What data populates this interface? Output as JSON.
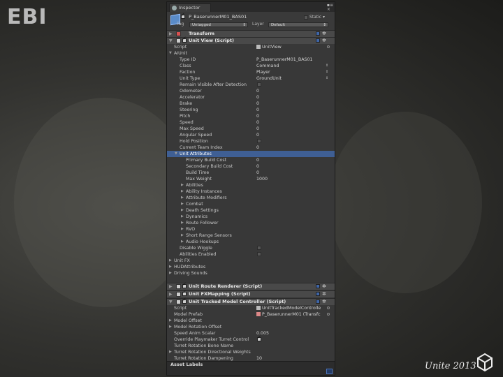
{
  "branding": {
    "logo_text": "EBI",
    "event_text": "Unite 2013"
  },
  "inspector": {
    "tab_label": "Inspector",
    "object": {
      "name": "P_BaserunnerM01_BAS01",
      "static_label": "Static",
      "tag_label": "Tag",
      "tag_value": "Untagged",
      "layer_label": "Layer",
      "layer_value": "Default"
    },
    "transform": {
      "title": "Transform"
    },
    "unit_view": {
      "title": "Unit View (Script)",
      "script_label": "Script",
      "script_value": "UnitView",
      "aiunit_label": "AIUnit",
      "fields": [
        {
          "label": "Type ID",
          "value": "P_BaserunnerM01_BAS01"
        },
        {
          "label": "Class",
          "value": "Command"
        },
        {
          "label": "Faction",
          "value": "Player"
        },
        {
          "label": "Unit Type",
          "value": "GroundUnit"
        },
        {
          "label": "Remain Visible After Detection",
          "value": ""
        },
        {
          "label": "Odometer",
          "value": "0"
        },
        {
          "label": "Accelerator",
          "value": "0"
        },
        {
          "label": "Brake",
          "value": "0"
        },
        {
          "label": "Steering",
          "value": "0"
        },
        {
          "label": "Pitch",
          "value": "0"
        },
        {
          "label": "Speed",
          "value": "0"
        },
        {
          "label": "Max Speed",
          "value": "0"
        },
        {
          "label": "Angular Speed",
          "value": "0"
        },
        {
          "label": "Hold Position",
          "value": ""
        },
        {
          "label": "Current Team Index",
          "value": "0"
        }
      ],
      "unit_attributes_label": "Unit Attributes",
      "attributes": [
        {
          "label": "Primary Build Cost",
          "value": "0"
        },
        {
          "label": "Secondary Build Cost",
          "value": "0"
        },
        {
          "label": "Build Time",
          "value": "0"
        },
        {
          "label": "Max Weight",
          "value": "1000"
        }
      ],
      "attribute_groups": [
        "Abilities",
        "Ability Instances",
        "Attribute Modifiers",
        "Combat",
        "Death Settings",
        "Dynamics",
        "Route Follower",
        "RVO",
        "Short Range Sensors",
        "Audio Hookups"
      ],
      "flags": [
        {
          "label": "Disable Wiggle",
          "value": ""
        },
        {
          "label": "Abilities Enabled",
          "value": ""
        }
      ],
      "other_groups": [
        "Unit FX",
        "HUDAttributes",
        "Driving Sounds"
      ]
    },
    "unit_route_renderer": {
      "title": "Unit Route Renderer (Script)"
    },
    "unit_fx_mapping": {
      "title": "Unit FXMapping (Script)"
    },
    "tracked_model": {
      "title": "Unit Tracked Model Controller (Script)",
      "rows": [
        {
          "label": "Script",
          "value": "UnitTrackedModelControlle"
        },
        {
          "label": "Model Prefab",
          "value": "P_BaserunnerM01 (Transfc"
        },
        {
          "label": "Model Offset",
          "value": ""
        },
        {
          "label": "Model Rotation Offset",
          "value": ""
        },
        {
          "label": "Speed Anim Scalar",
          "value": "0.005"
        },
        {
          "label": "Override Playmaker Turret Control",
          "value": ""
        },
        {
          "label": "Turret Rotation Bone Name",
          "value": ""
        },
        {
          "label": "Turret Rotation Directional Weights",
          "value": ""
        },
        {
          "label": "Turret Rotation Dampening",
          "value": "10"
        }
      ]
    },
    "asset_labels": "Asset Labels"
  }
}
